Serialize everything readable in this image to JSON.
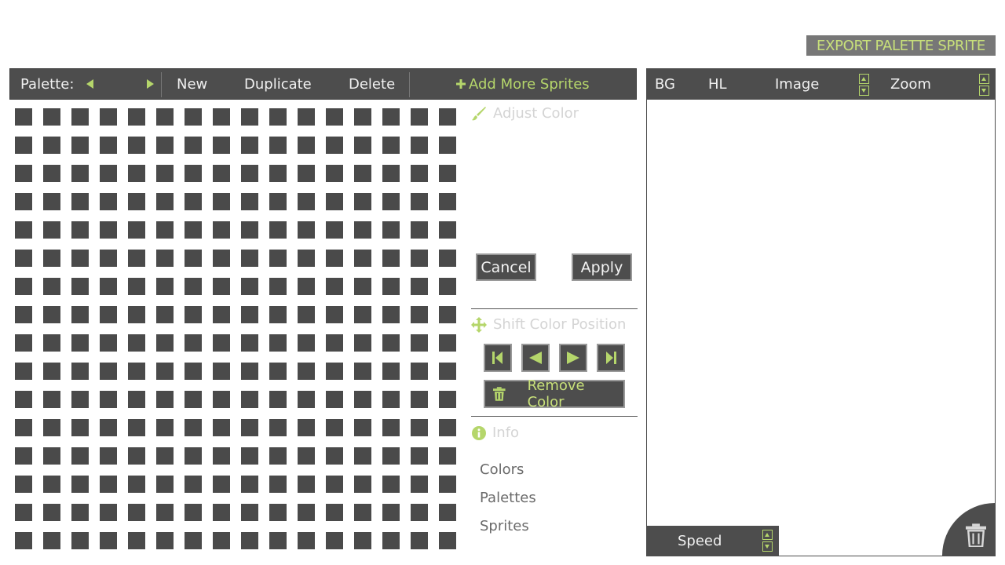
{
  "header": {
    "export_label": "EXPORT PALETTE SPRITE"
  },
  "toolbar": {
    "palette_label": "Palette:",
    "new_label": "New",
    "duplicate_label": "Duplicate",
    "delete_label": "Delete",
    "add_sprites_label": "Add More Sprites"
  },
  "color_grid": {
    "rows": 16,
    "cols": 16,
    "swatch_color": "#4a4a4a"
  },
  "adjust_color": {
    "title": "Adjust Color",
    "cancel_label": "Cancel",
    "apply_label": "Apply"
  },
  "shift_color": {
    "title": "Shift Color Position",
    "remove_label": "Remove Color"
  },
  "info": {
    "title": "Info",
    "lines": [
      "Colors",
      "Palettes",
      "Sprites"
    ]
  },
  "preview": {
    "bg_label": "BG",
    "hl_label": "HL",
    "image_label": "Image",
    "zoom_label": "Zoom",
    "speed_label": "Speed"
  },
  "colors": {
    "accent": "#b5d66b",
    "accent_text": "#c8e07a",
    "panel": "#4d4d4d",
    "export_bg": "#777777"
  },
  "icons": {
    "adjust": "brush-icon",
    "shift": "move-arrows-icon",
    "info": "info-icon",
    "remove": "trash-icon",
    "delete_preview": "trash-icon"
  }
}
